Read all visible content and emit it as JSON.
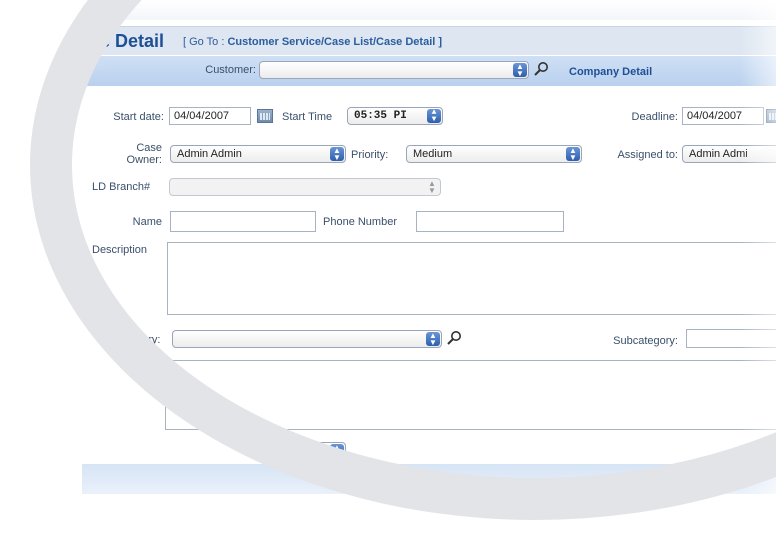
{
  "header": {
    "title": "e Detail",
    "breadcrumb_goto": "[ Go To :",
    "breadcrumb_path": "Customer Service/Case List/Case Detail ]"
  },
  "customer": {
    "label": "Customer:",
    "value": "",
    "company_link": "Company Detail"
  },
  "schedule": {
    "start_date_label": "Start date:",
    "start_date_value": "04/04/2007",
    "start_time_label": "Start Time",
    "start_time_value": "05:35 PI",
    "deadline_label": "Deadline:",
    "deadline_value": "04/04/2007"
  },
  "assignment": {
    "case_owner_label_1": "Case",
    "case_owner_label_2": "Owner:",
    "case_owner_value": "Admin Admin",
    "priority_label": "Priority:",
    "priority_value": "Medium",
    "assigned_label": "Assigned to:",
    "assigned_value": "Admin Admi"
  },
  "branch": {
    "label": "LD Branch#",
    "value": ""
  },
  "contact": {
    "name_label": "Name",
    "name_value": "",
    "phone_label": "Phone Number",
    "phone_value": ""
  },
  "description": {
    "label": "Description"
  },
  "category": {
    "label": "gory:",
    "value": "",
    "subcategory_label": "Subcategory:",
    "subcategory_value": ""
  },
  "colors": {
    "title": "#1f4f95",
    "label": "#3a4f6c",
    "band": "#cfe0f5",
    "arrow": "#2e5fae",
    "arc": "#e3e4e8"
  },
  "icons": [
    "magnifier-icon",
    "calendar-icon",
    "select-arrow-icon"
  ]
}
